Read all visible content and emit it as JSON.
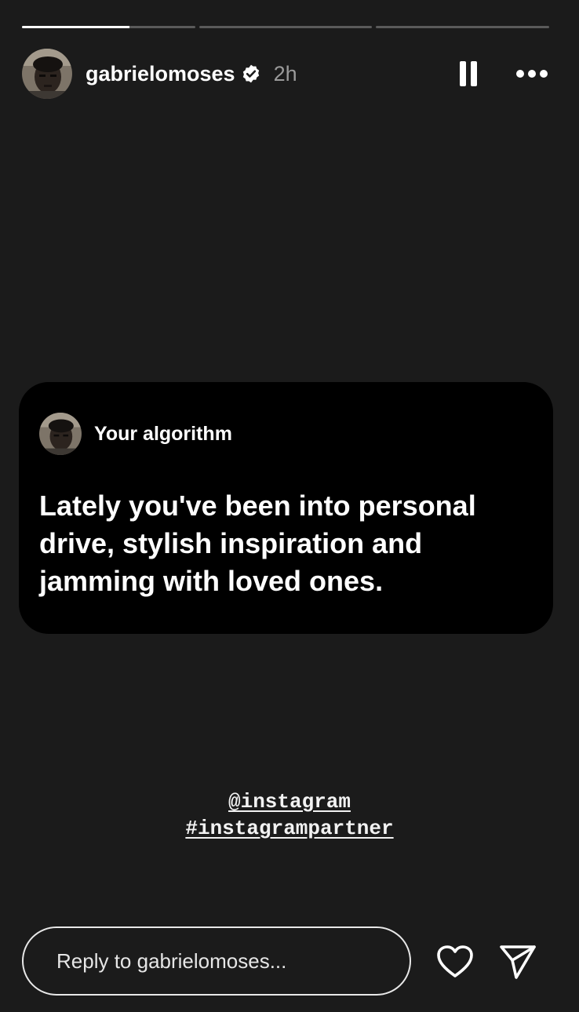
{
  "progress": [
    {
      "segment": 1,
      "fraction": 0.62
    },
    {
      "segment": 2,
      "fraction": 0
    },
    {
      "segment": 3,
      "fraction": 0
    }
  ],
  "header": {
    "username": "gabrielomoses",
    "time": "2h",
    "verified_icon": "verified-badge-icon",
    "pause_icon": "pause-icon",
    "more_icon": "more-options-icon"
  },
  "card": {
    "title": "Your algorithm",
    "body": "Lately you've been into personal drive, stylish inspiration and jamming with loved ones."
  },
  "tags": {
    "mention": "@instagram",
    "hashtag": "#instagrampartner"
  },
  "footer": {
    "reply_placeholder": "Reply to gabrielomoses...",
    "like_icon": "heart-icon",
    "share_icon": "send-icon"
  },
  "colors": {
    "background": "#1b1b1b",
    "card": "#000000",
    "muted_text": "#9a9a9a"
  }
}
